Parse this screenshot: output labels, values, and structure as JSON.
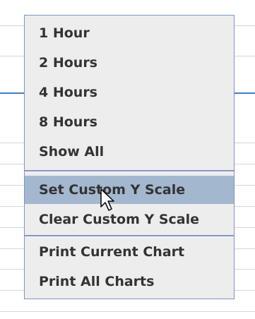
{
  "menu": {
    "items": [
      {
        "label": "1 Hour"
      },
      {
        "label": "2 Hours"
      },
      {
        "label": "4 Hours"
      },
      {
        "label": "8 Hours"
      },
      {
        "label": "Show All"
      },
      {
        "label": "Set Custom Y Scale",
        "state": "highlighted"
      },
      {
        "label": "Clear Custom Y Scale"
      },
      {
        "label": "Print Current Chart"
      },
      {
        "label": "Print All Charts"
      }
    ]
  },
  "colors": {
    "menu_background": "#ededed",
    "menu_border": "#7f95c4",
    "highlight": "#a3b7cf",
    "text": "#333333",
    "chart_line": "#4a78c6"
  },
  "cursor": {
    "icon": "mouse-pointer-icon"
  }
}
